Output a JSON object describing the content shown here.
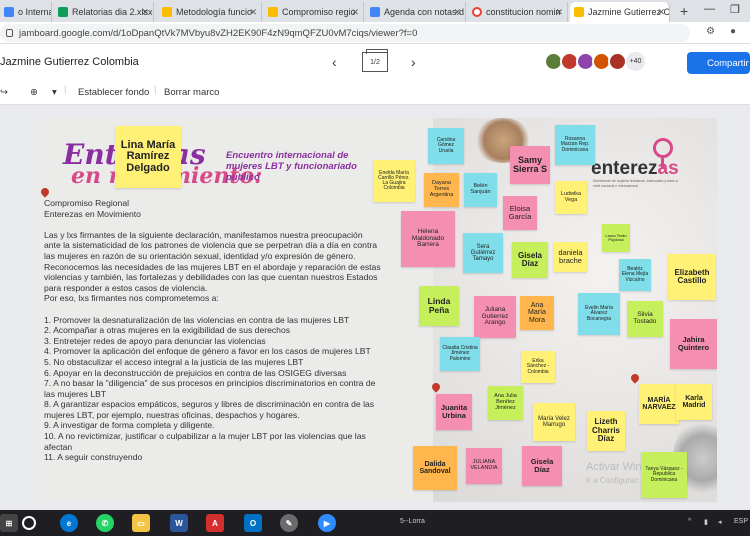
{
  "browser": {
    "tabs": [
      {
        "label": "o Internacio",
        "color": "#4285f4"
      },
      {
        "label": "Relatorias dia 2.xlsx",
        "color": "#0f9d58"
      },
      {
        "label": "Metodología funcio",
        "color": "#fbbc04"
      },
      {
        "label": "Compromiso regio",
        "color": "#fbbc04"
      },
      {
        "label": "Agenda con notas.d",
        "color": "#4285f4"
      },
      {
        "label": "constitucion nomin",
        "color": "#ea4335"
      },
      {
        "label": "Jazmine Gutierrez C",
        "color": "#fbbc04"
      }
    ],
    "new_tab": "+",
    "minimize": "—",
    "restore": "❐",
    "url": "jamboard.google.com/d/1oDpanQtVk7MVbyu8vZH2EK90F4zN9qmQFZU0vM7ciqs/viewer?f=0"
  },
  "app": {
    "title": "Jazmine Gutierrez Colombia",
    "page_indicator": "1/2",
    "prev_icon": "‹",
    "next_icon": "›",
    "more_count": "+40",
    "share_label": "Compartir",
    "avatar_colors": [
      "#5b7d3a",
      "#c0392b",
      "#8e44ad",
      "#d35400",
      "#a93226"
    ]
  },
  "toolbar": {
    "zoom_icon": "🔍",
    "background_label": "Establecer fondo",
    "clear_label": "Borrar marco"
  },
  "slide": {
    "title_line1": "Entenzas",
    "title_line2": "en movimiento:",
    "encuentro": "Encuentro internacional de mujeres LBT y funcionariado público",
    "logo_main": "enterez",
    "logo_accent": "as",
    "logo_sub": "Movimiento de mujeres lesbianas, bisexuales y trans a nivel nacional e internacional",
    "body_lines": [
      "Compromiso Regional",
      "Enterezas en Movimiento",
      "",
      "Las y lxs firmantes de la siguiente declaración, manifestamos nuestra preocupación",
      "ante la sistematicidad de los patrones de violencia que se perpetran día a día en contra",
      "las mujeres en razón de su orientación sexual, identidad y/o expresión de género.",
      "Reconocemos las necesidades de las mujeres LBT en el abordaje y reparación de estas",
      "violencias y también, las fortalezas y debilidades con las que cuentan nuestros Estados",
      "para responder a estos casos de violencia.",
      "Por eso, lxs firmantes nos comprometemos a:",
      "",
      "1. Promover la desnaturalización de las violencias en contra de las mujeres LBT",
      "2. Acompañar a otras mujeres en la exigibilidad de sus derechos",
      "3. Entretejer redes de apoyo para denunciar las violencias",
      "4. Promover la aplicación del enfoque de género a favor en los casos de mujeres LBT",
      "5. No obstaculizar el acceso integral a la justicia de las mujeres LBT",
      "6. Apoyar en la deconstrucción de prejuicios en contra de las OSIGEG diversas",
      "7. A no basar la \"diligencia\" de sus procesos en principios discriminatorios en contra de",
      "las mujeres LBT",
      "8. A garantizar espacios empáticos, seguros y libres de discriminación en contra de las",
      "mujeres LBT, por ejemplo, nuestras oficinas, despachos y hogares.",
      "9. A investigar de forma completa y diligente.",
      "10. A no revictimizar, justificar o culpabilizar a la mujer LBT por las violencias que las",
      "afectan",
      "11. A seguir construyendo"
    ],
    "watermark_1": "Activar Win",
    "watermark_2": "Ir a Configurac"
  },
  "notes": [
    {
      "text": "Lina María Ramírez Delgado",
      "color": "#fff176"
    },
    {
      "text": "Carolina Gómez Uruela",
      "color": "#80deea"
    },
    {
      "text": "Rosanna Marzan Rep. Dominicana",
      "color": "#80deea"
    },
    {
      "text": "Samy Sierra S",
      "color": "#f48fb1"
    },
    {
      "text": "Enelda María Carrillo Pérez. La Guajira Colombia",
      "color": "#fff176"
    },
    {
      "text": "Dayana Torres Argentina",
      "color": "#ffb74d"
    },
    {
      "text": "Belén Sanjuán",
      "color": "#80deea"
    },
    {
      "text": "Eloisa García",
      "color": "#f48fb1"
    },
    {
      "text": "Ludwika Vega",
      "color": "#fff176"
    },
    {
      "text": "Helena Maldonado Barrera",
      "color": "#f48fb1"
    },
    {
      "text": "Sera Gutiérrez Tamayo",
      "color": "#80deea"
    },
    {
      "text": "Gisela Díaz",
      "color": "#c6ef5c"
    },
    {
      "text": "daniela brache",
      "color": "#fff176"
    },
    {
      "text": "Laura Terán Pujolosa",
      "color": "#c6ef5c"
    },
    {
      "text": "Beatriz Elena Mejía Vizcaíno",
      "color": "#80deea"
    },
    {
      "text": "Elizabeth Castillo",
      "color": "#fff176"
    },
    {
      "text": "Linda Peña",
      "color": "#c6ef5c"
    },
    {
      "text": "Juliana Gutierrez Arango",
      "color": "#f48fb1"
    },
    {
      "text": "Ana María Mora",
      "color": "#ffb74d"
    },
    {
      "text": "Evelin María Álvarez Bocanegra",
      "color": "#80deea"
    },
    {
      "text": "Silvia Tostado",
      "color": "#c6ef5c"
    },
    {
      "text": "Jahira Quintero",
      "color": "#f48fb1"
    },
    {
      "text": "Claudia Cristina Jiménez Palomino",
      "color": "#80deea"
    },
    {
      "text": "Erika Sánchez - Colombia",
      "color": "#fff176"
    },
    {
      "text": "Ana Julia Benítez Jiménez",
      "color": "#c6ef5c"
    },
    {
      "text": "Juanita Urbina",
      "color": "#f48fb1"
    },
    {
      "text": "María Velez Marrugo",
      "color": "#fff176"
    },
    {
      "text": "Lizeth Charris Díaz",
      "color": "#fff176"
    },
    {
      "text": "MARÍA NARVAEZ",
      "color": "#fff176"
    },
    {
      "text": "Karla Madrid",
      "color": "#fff176"
    },
    {
      "text": "Dalida Sandoval",
      "color": "#ffb74d"
    },
    {
      "text": "JULIANA VELANDIA",
      "color": "#f48fb1"
    },
    {
      "text": "Gisela Díaz",
      "color": "#f48fb1"
    },
    {
      "text": "Tanya Vásquez - Republica Dominicana",
      "color": "#c6ef5c"
    }
  ],
  "taskbar": {
    "language": "ESP",
    "task_label": "5--Lorra"
  }
}
